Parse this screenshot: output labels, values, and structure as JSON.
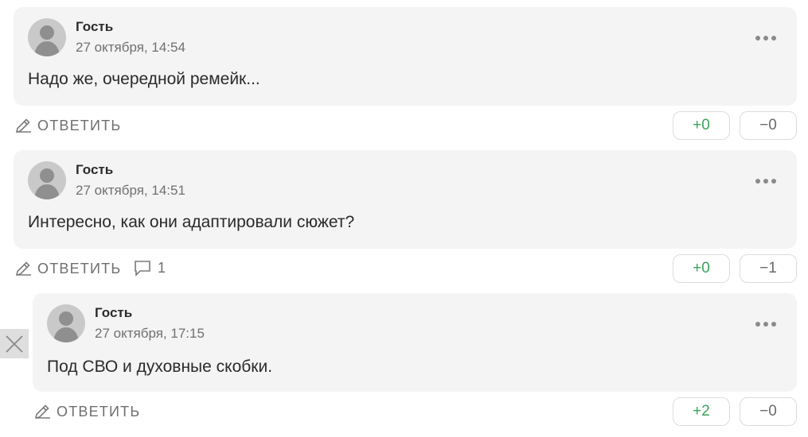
{
  "comments": [
    {
      "author": "Гость",
      "date": "27 октября, 14:54",
      "text": "Надо же, очередной ремейк...",
      "reply_label": "ОТВЕТИТЬ",
      "plus_votes": "+0",
      "minus_votes": "−0"
    },
    {
      "author": "Гость",
      "date": "27 октября, 14:51",
      "text": "Интересно, как они адаптировали сюжет?",
      "reply_label": "ОТВЕТИТЬ",
      "reply_count": "1",
      "plus_votes": "+0",
      "minus_votes": "−1"
    },
    {
      "author": "Гость",
      "date": "27 октября, 17:15",
      "text": "Под СВО и духовные скобки.",
      "reply_label": "ОТВЕТИТЬ",
      "plus_votes": "+2",
      "minus_votes": "−0"
    }
  ],
  "icons": {
    "more": "more-options-icon",
    "reply": "pencil-icon",
    "count": "comment-bubble-icon",
    "close": "close-icon",
    "avatar": "user-avatar-icon"
  },
  "colors": {
    "card_bg": "#f4f4f4",
    "plus": "#3aa35a",
    "minus": "#6b6b6b",
    "muted": "#6f6f6f"
  }
}
